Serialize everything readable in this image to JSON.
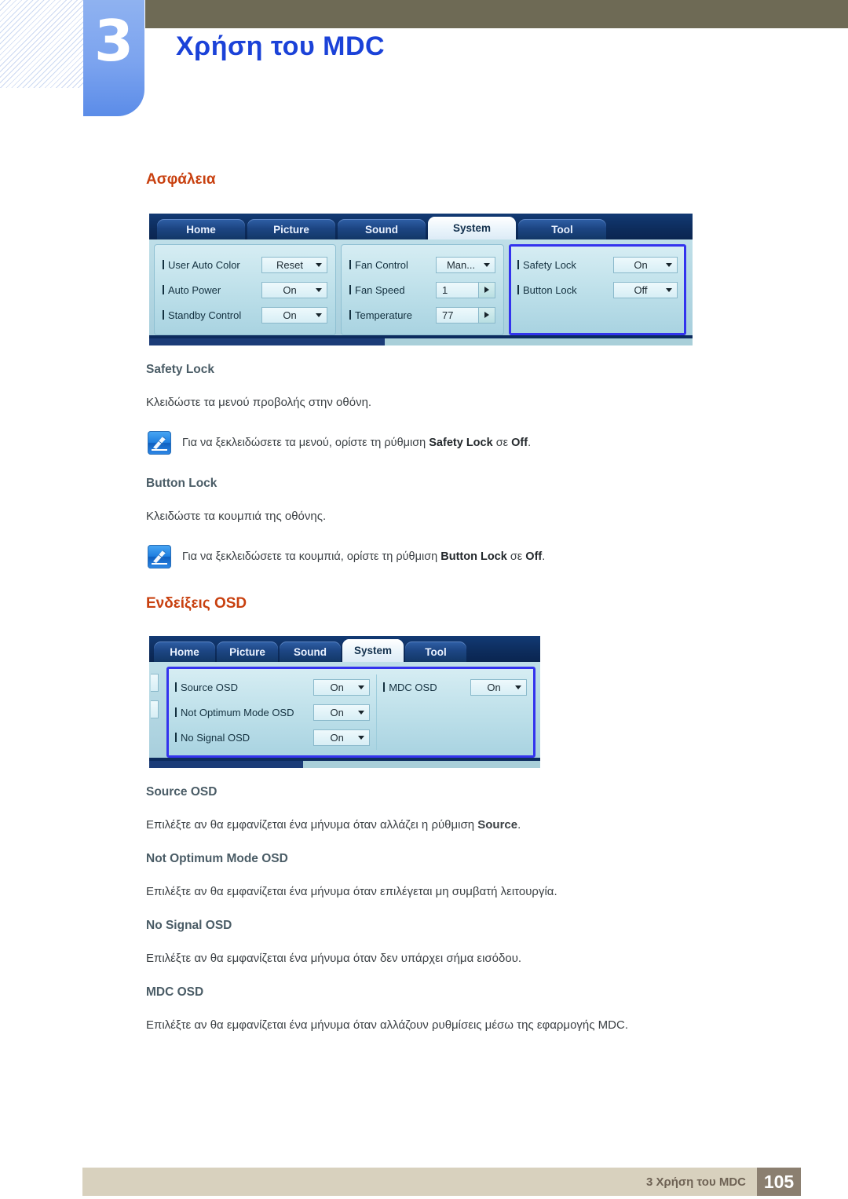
{
  "header": {
    "chapter_number": "3",
    "chapter_title": "Χρήση του MDC"
  },
  "sections": [
    {
      "heading": "Ασφάλεια",
      "items": [
        {
          "title": "Safety Lock",
          "body": "Κλειδώστε τα μενού προβολής στην οθόνη.",
          "note_prefix": "Για να ξεκλειδώσετε τα μενού, ορίστε τη ρύθμιση ",
          "note_bold1": "Safety Lock",
          "note_mid": " σε ",
          "note_bold2": "Off",
          "note_suffix": "."
        },
        {
          "title": "Button Lock",
          "body": "Κλειδώστε τα κουμπιά της οθόνης.",
          "note_prefix": "Για να ξεκλειδώσετε τα κουμπιά, ορίστε τη ρύθμιση ",
          "note_bold1": "Button Lock",
          "note_mid": " σε ",
          "note_bold2": "Off",
          "note_suffix": "."
        }
      ]
    },
    {
      "heading": "Ενδείξεις OSD",
      "items": [
        {
          "title": "Source OSD",
          "body_prefix": "Επιλέξτε αν θα εμφανίζεται ένα μήνυμα όταν αλλάζει η ρύθμιση ",
          "body_bold": "Source",
          "body_suffix": "."
        },
        {
          "title": "Not Optimum Mode OSD",
          "body": "Επιλέξτε αν θα εμφανίζεται ένα μήνυμα όταν επιλέγεται μη συμβατή λειτουργία."
        },
        {
          "title": "No Signal OSD",
          "body": "Επιλέξτε αν θα εμφανίζεται ένα μήνυμα όταν δεν υπάρχει σήμα εισόδου."
        },
        {
          "title": "MDC OSD",
          "body": "Επιλέξτε αν θα εμφανίζεται ένα μήνυμα όταν αλλάζουν ρυθμίσεις μέσω της εφαρμογής MDC."
        }
      ]
    }
  ],
  "mdc_panel_system": {
    "tabs": [
      {
        "label": "Home",
        "active": false
      },
      {
        "label": "Picture",
        "active": false
      },
      {
        "label": "Sound",
        "active": false
      },
      {
        "label": "System",
        "active": true
      },
      {
        "label": "Tool",
        "active": false
      }
    ],
    "group1": [
      {
        "label": "User Auto Color",
        "value": "Reset",
        "type": "select"
      },
      {
        "label": "Auto Power",
        "value": "On",
        "type": "select"
      },
      {
        "label": "Standby Control",
        "value": "On",
        "type": "select"
      }
    ],
    "group2": [
      {
        "label": "Fan Control",
        "value": "Man...",
        "type": "select"
      },
      {
        "label": "Fan Speed",
        "value": "1",
        "type": "spinner"
      },
      {
        "label": "Temperature",
        "value": "77",
        "type": "spinner"
      }
    ],
    "group3": [
      {
        "label": "Safety Lock",
        "value": "On",
        "type": "select"
      },
      {
        "label": "Button Lock",
        "value": "Off",
        "type": "select"
      }
    ]
  },
  "mdc_panel_osd": {
    "tabs": [
      {
        "label": "Home",
        "active": false
      },
      {
        "label": "Picture",
        "active": false
      },
      {
        "label": "Sound",
        "active": false
      },
      {
        "label": "System",
        "active": true
      },
      {
        "label": "Tool",
        "active": false
      }
    ],
    "group1": [
      {
        "label": "Source OSD",
        "value": "On",
        "type": "select"
      },
      {
        "label": "Not Optimum Mode OSD",
        "value": "On",
        "type": "select"
      },
      {
        "label": "No Signal OSD",
        "value": "On",
        "type": "select"
      }
    ],
    "group2": [
      {
        "label": "MDC OSD",
        "value": "On",
        "type": "select"
      }
    ]
  },
  "footer": {
    "text": "3 Χρήση του MDC",
    "page": "105"
  },
  "colors": {
    "chapter_title": "#1b42d8",
    "section_heading": "#c8400f",
    "sub_heading": "#4a5c66",
    "olive_bar": "#6e6a55",
    "highlight_box": "#3333ee",
    "footer_bar": "#d8d1be",
    "footer_page_bg": "#8b7f70"
  }
}
